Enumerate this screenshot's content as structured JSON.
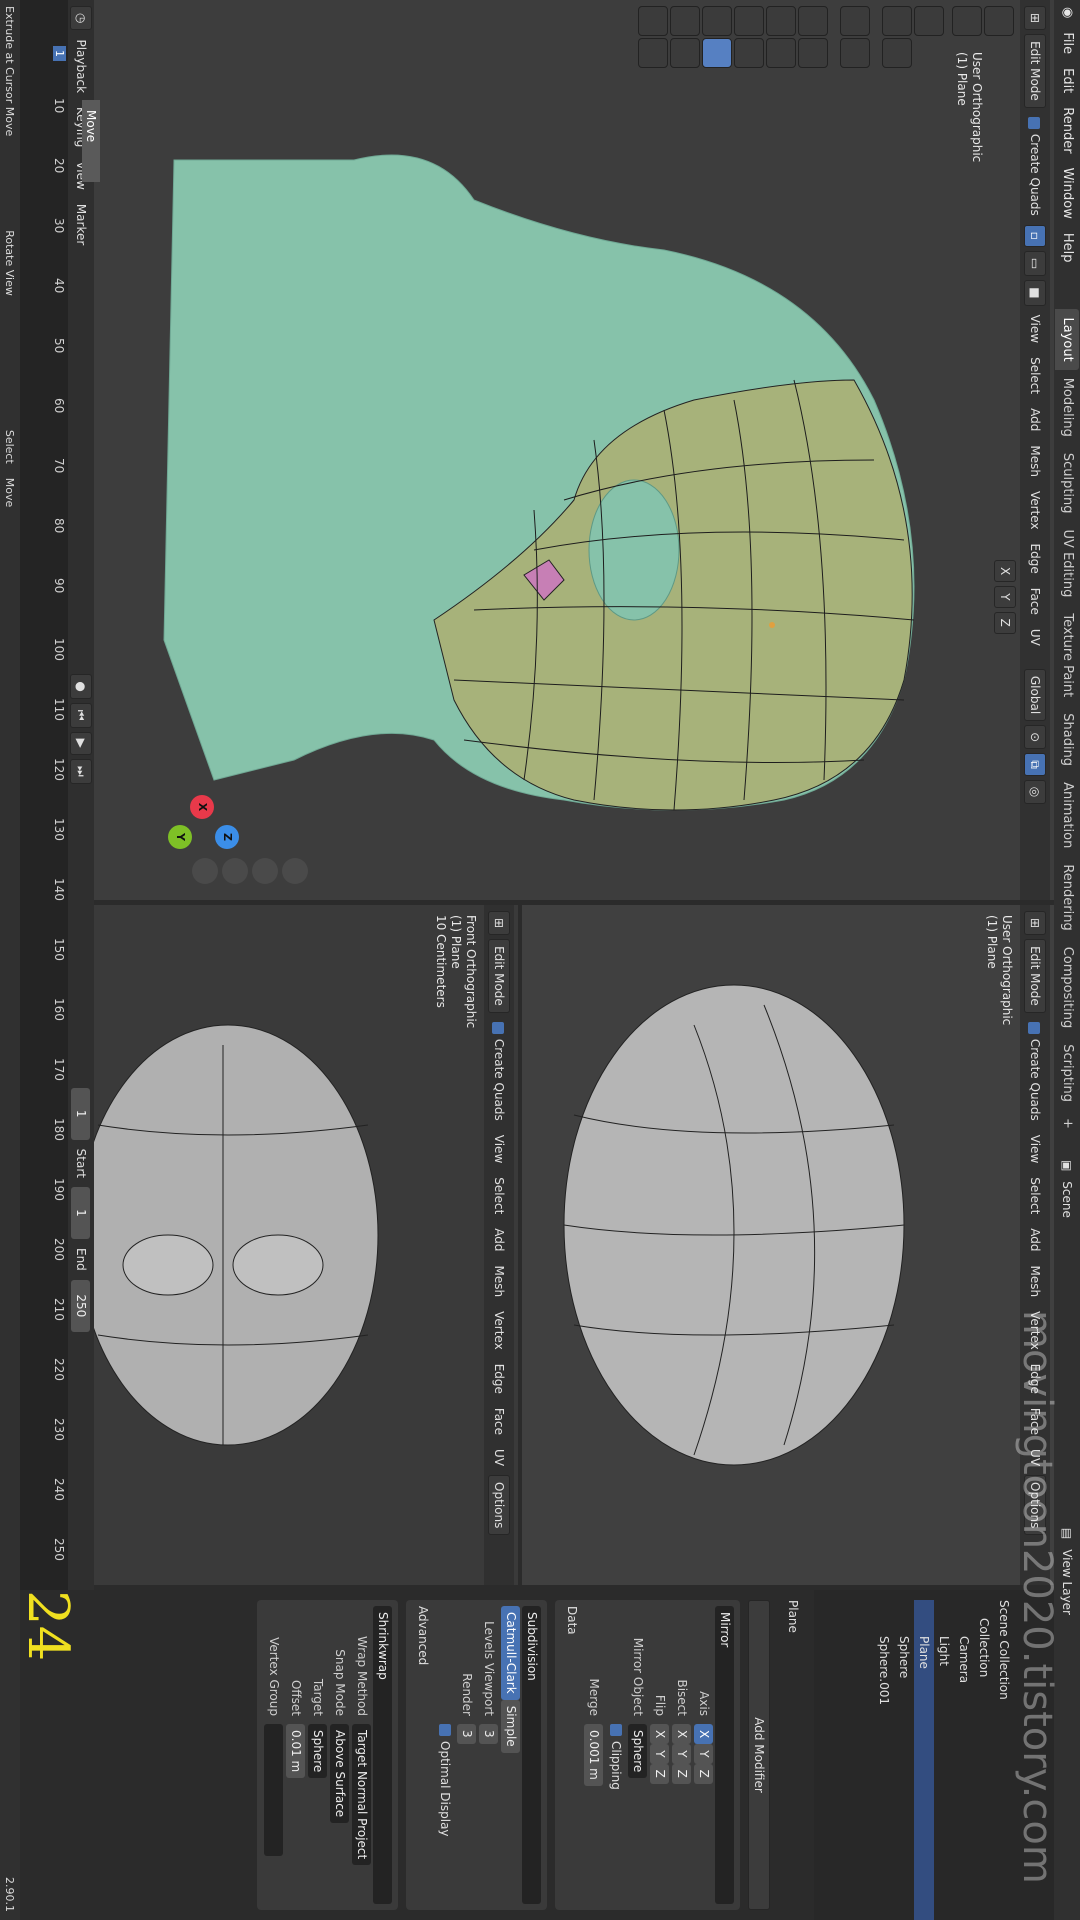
{
  "top_menu": [
    "File",
    "Edit",
    "Render",
    "Window",
    "Help"
  ],
  "workspace_tabs": [
    "Layout",
    "Modeling",
    "Sculpting",
    "UV Editing",
    "Texture Paint",
    "Shading",
    "Animation",
    "Rendering",
    "Compositing",
    "Scripting"
  ],
  "active_workspace": "Layout",
  "plus_tab": "+",
  "scene_label": "Scene",
  "view_layer_label": "View Layer",
  "viewport_header": {
    "mode": "Edit Mode",
    "create_quads": "Create Quads",
    "view": "View",
    "select": "Select",
    "add": "Add",
    "mesh": "Mesh",
    "vertex": "Vertex",
    "edge": "Edge",
    "face": "Face",
    "uv": "UV",
    "orientation": "Global",
    "x": "X",
    "y": "Y",
    "z": "Z",
    "options": "Options"
  },
  "main_viewport": {
    "line1": "User Orthographic",
    "line2": "(1) Plane"
  },
  "top_right_viewport": {
    "line1": "User Orthographic",
    "line2": "(1) Plane"
  },
  "front_viewport": {
    "line1": "Front Orthographic",
    "line2": "(1) Plane",
    "line3": "10 Centimeters"
  },
  "operator_panel": "Move",
  "timeline": {
    "playback": "Playback",
    "keying": "Keying",
    "view": "View",
    "marker": "Marker",
    "current_frame": "1",
    "start_label": "Start",
    "start": "1",
    "end_label": "End",
    "end": "250",
    "ticks": [
      "10",
      "20",
      "30",
      "40",
      "50",
      "60",
      "70",
      "80",
      "90",
      "100",
      "110",
      "120",
      "130",
      "140",
      "150",
      "160",
      "170",
      "180",
      "190",
      "200",
      "210",
      "220",
      "230",
      "240",
      "250"
    ]
  },
  "status_bar": {
    "extrude": "Extrude at Cursor Move",
    "rotate": "Rotate View",
    "select": "Select",
    "move": "Move",
    "version": "2.90.1"
  },
  "outliner": {
    "items": [
      "Scene Collection",
      "Collection",
      "Camera",
      "Light",
      "Plane",
      "Sphere",
      "Sphere.001"
    ]
  },
  "properties": {
    "object_name": "Plane",
    "add_modifier": "Add Modifier",
    "mirror": {
      "name": "Mirror",
      "axis_label": "Axis",
      "bisect_label": "Bisect",
      "flip_label": "Flip",
      "x": "X",
      "y": "Y",
      "z": "Z",
      "mirror_object_label": "Mirror Object",
      "mirror_object": "Sphere",
      "clipping": "Clipping",
      "merge_label": "Merge",
      "merge_value": "0.001 m",
      "data_label": "Data"
    },
    "subdivision": {
      "name": "Subdivision",
      "catmull": "Catmull-Clark",
      "simple": "Simple",
      "levels_label": "Levels Viewport",
      "levels": "3",
      "render_label": "Render",
      "render": "3",
      "optimal": "Optimal Display",
      "advanced": "Advanced"
    },
    "shrinkwrap": {
      "name": "Shrinkwrap",
      "wrap_label": "Wrap Method",
      "wrap": "Target Normal Project",
      "snap_label": "Snap Mode",
      "snap": "Above Surface",
      "target_label": "Target",
      "target": "Sphere",
      "offset_label": "Offset",
      "offset": "0.01 m",
      "vgroup_label": "Vertex Group"
    }
  },
  "watermark": "movingtoon2020.tistory.com",
  "page_number": "24",
  "colors": {
    "accent": "#4772b3",
    "mesh_green": "#a7b27a",
    "face_pink": "#c77fb5",
    "x_axis": "#e8394a",
    "y_axis": "#7ec026",
    "z_axis": "#3b8ee8"
  }
}
